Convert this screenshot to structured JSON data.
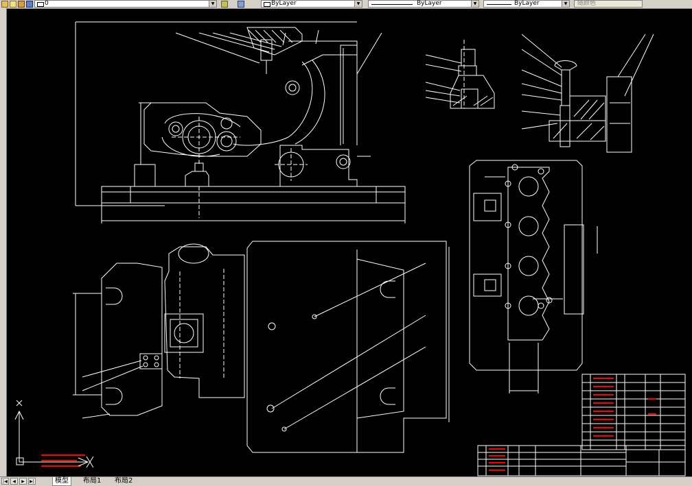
{
  "toolbar": {
    "layer_value": "0",
    "color_value": "ByLayer",
    "linetype_value": "ByLayer",
    "lineweight_value": "ByLayer",
    "plotstyle_value": "随颜色"
  },
  "tabs": {
    "model": "模型",
    "layout1": "布局1",
    "layout2": "布局2"
  },
  "colors": {
    "background": "#000000",
    "lines": "#ffffff",
    "annotation_red": "#ff0000",
    "ucs": "#ffffff"
  }
}
